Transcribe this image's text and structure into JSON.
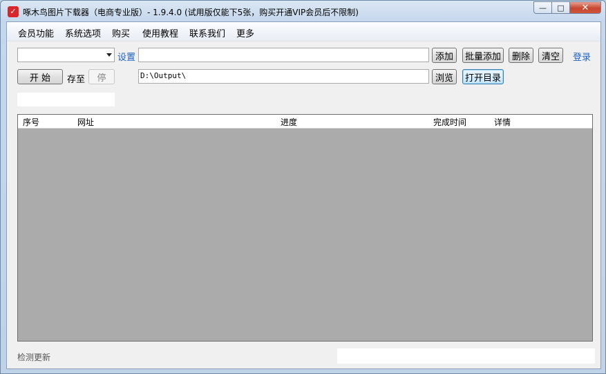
{
  "window": {
    "title": "啄木鸟图片下载器（电商专业版）- 1.9.4.0 (试用版仅能下5张，购买开通VIP会员后不限制)",
    "controls": {
      "minimize": "—",
      "maximize": "□",
      "close": "✕"
    }
  },
  "menu": {
    "items": [
      "会员功能",
      "系统选项",
      "购买",
      "使用教程",
      "联系我们",
      "更多"
    ]
  },
  "toolbar": {
    "settings_link": "设置",
    "url_input_value": "",
    "add": "添加",
    "batch_add": "批量添加",
    "delete": "删除",
    "clear": "清空",
    "login_link": "登录"
  },
  "row2": {
    "start": "开 始",
    "save_to": "存至",
    "stop": "停",
    "output_path": "D:\\Output\\",
    "browse": "浏览",
    "open_dir": "打开目录"
  },
  "table": {
    "columns": [
      "序号",
      "网址",
      "进度",
      "完成时间",
      "详情"
    ],
    "rows": []
  },
  "status": {
    "check_update": "检测更新"
  },
  "icons": {
    "app": "woodpecker-app-icon",
    "dropdown": "chevron-down-icon"
  },
  "colors": {
    "link": "#1c63c6",
    "close_button": "#c8462e",
    "grid_background": "#ababab"
  }
}
